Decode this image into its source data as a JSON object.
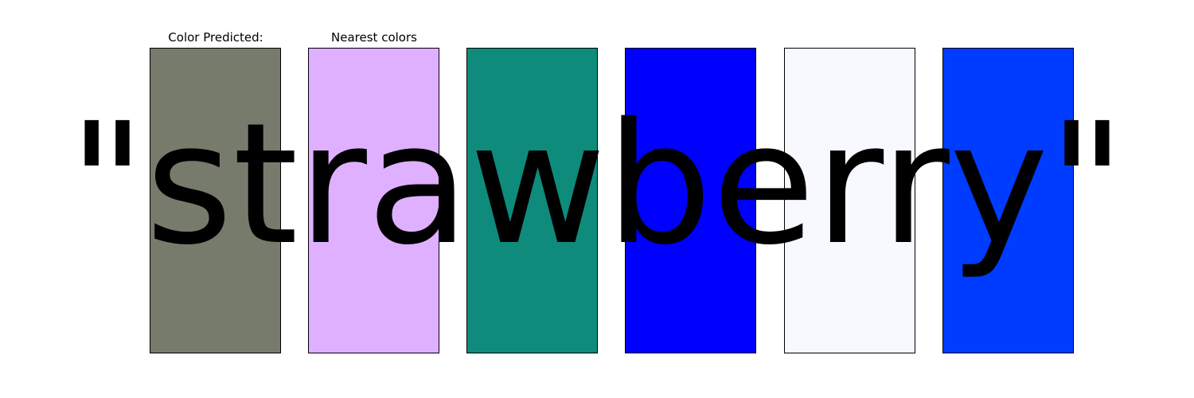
{
  "labels": {
    "predicted": "Color Predicted:",
    "nearest": "Nearest colors"
  },
  "swatches": [
    {
      "role": "predicted",
      "color": "#767B6C"
    },
    {
      "role": "nearest",
      "color": "#DFB0FF"
    },
    {
      "role": "nearest",
      "color": "#0F8B7C"
    },
    {
      "role": "nearest",
      "color": "#0000FF"
    },
    {
      "role": "nearest",
      "color": "#F8F9FF"
    },
    {
      "role": "nearest",
      "color": "#003CFF"
    }
  ],
  "word": "\"strawberry\""
}
